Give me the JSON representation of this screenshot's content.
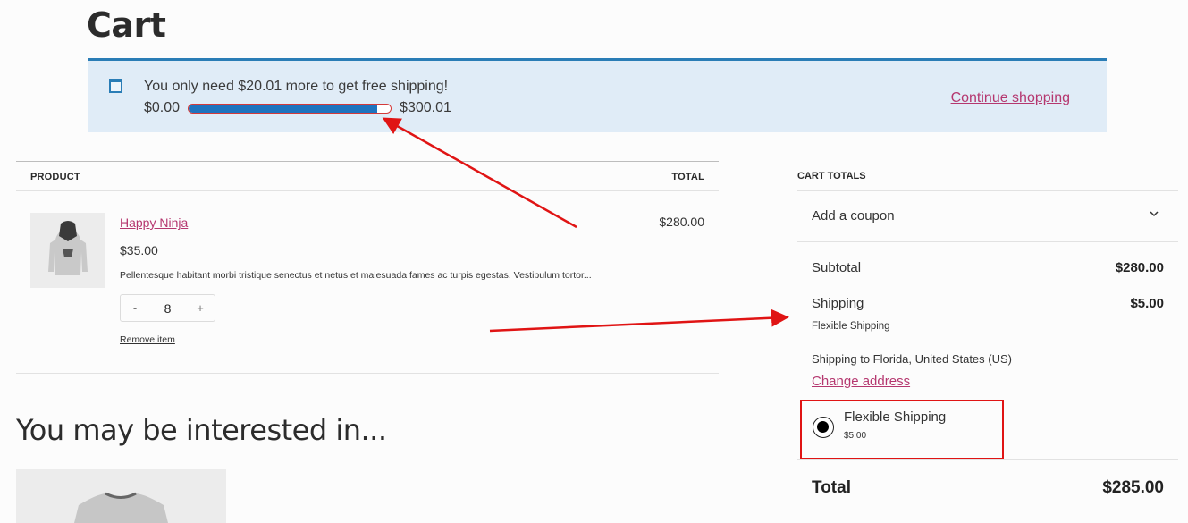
{
  "page": {
    "title": "Cart"
  },
  "notice": {
    "icon": "window-icon",
    "message": "You only need $20.01 more to get free shipping!",
    "progress_min_label": "$0.00",
    "progress_max_label": "$300.01",
    "progress_fraction": 0.933,
    "continue_label": "Continue shopping",
    "accent_color": "#2a7db6",
    "fill_color": "#1f73be"
  },
  "cart_table": {
    "headers": {
      "product": "PRODUCT",
      "total": "TOTAL"
    },
    "items": [
      {
        "name": "Happy Ninja",
        "price": "$35.00",
        "description": "Pellentesque habitant morbi tristique senectus et netus et malesuada fames ac turpis egestas. Vestibulum tortor...",
        "quantity": "8",
        "decrement": "-",
        "increment": "+",
        "remove_label": "Remove item",
        "line_total": "$280.00",
        "image": "hoodie-image"
      }
    ]
  },
  "upsell": {
    "title": "You may be interested in...",
    "image": "tshirt-image"
  },
  "totals": {
    "title": "CART TOTALS",
    "coupon_label": "Add a coupon",
    "subtotal_label": "Subtotal",
    "subtotal_value": "$280.00",
    "shipping_label": "Shipping",
    "shipping_value": "$5.00",
    "shipping_method": "Flexible Shipping",
    "shipping_to": "Shipping to Florida, United States (US)",
    "change_address": "Change address",
    "option_name": "Flexible Shipping",
    "option_price": "$5.00",
    "total_label": "Total",
    "total_value": "$285.00"
  },
  "colors": {
    "link": "#b5376f",
    "annotation": "#e01414"
  }
}
